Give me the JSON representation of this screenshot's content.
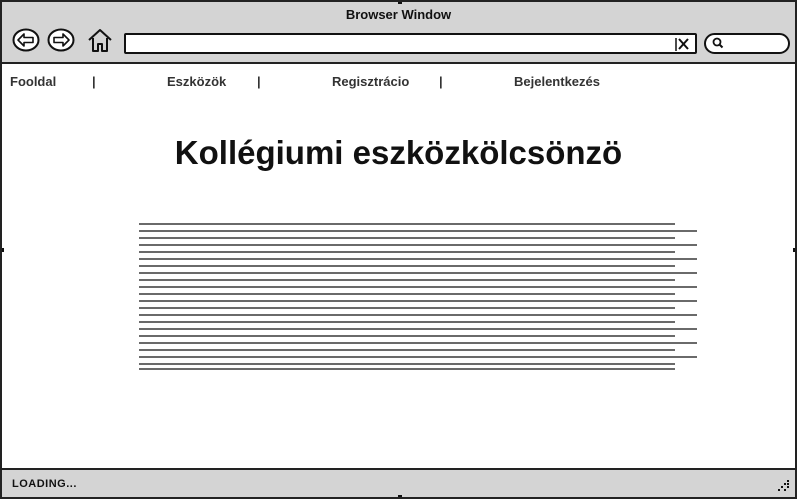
{
  "window": {
    "title": "Browser Window",
    "status": "LOADING..."
  },
  "toolbar": {
    "back_icon": "back-arrow-icon",
    "forward_icon": "forward-arrow-icon",
    "home_icon": "home-icon",
    "url_value": "",
    "clear_icon": "close-icon",
    "search_value": "",
    "search_icon": "search-icon"
  },
  "menu": {
    "items": [
      {
        "label": "Fooldal"
      },
      {
        "label": "Eszközök"
      },
      {
        "label": "Regisztrácio"
      },
      {
        "label": "Bejelentkezés"
      }
    ],
    "separator": "|"
  },
  "main": {
    "heading": "Kollégiumi eszközkölcsönzö"
  }
}
